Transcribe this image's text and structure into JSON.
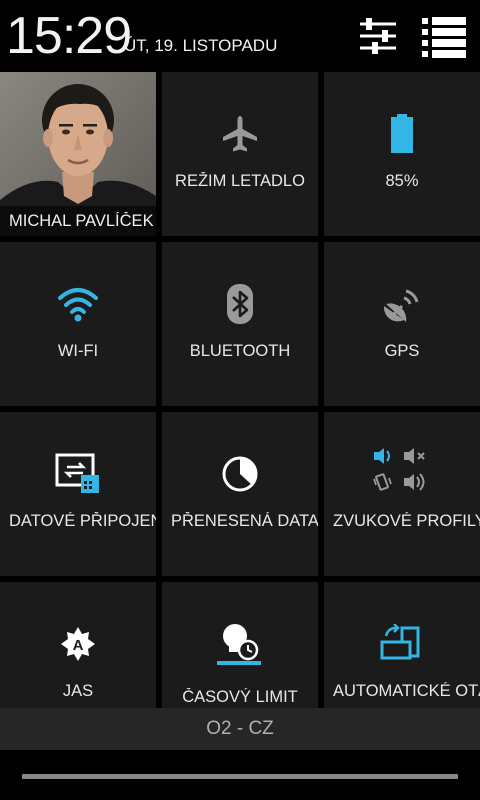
{
  "status": {
    "time": "15:29",
    "date": "ÚT, 19. LISTOPADU"
  },
  "header": {
    "settings_icon": "sliders-icon",
    "list_icon": "list-icon"
  },
  "tiles": {
    "user": {
      "name": "MICHAL PAVLÍČEK"
    },
    "airplane": {
      "label": "REŽIM LETADLO",
      "icon": "airplane-icon"
    },
    "battery": {
      "label": "85%",
      "icon": "battery-icon",
      "level": 0.85
    },
    "wifi": {
      "label": "WI-FI",
      "icon": "wifi-icon"
    },
    "bluetooth": {
      "label": "BLUETOOTH",
      "icon": "bluetooth-icon"
    },
    "gps": {
      "label": "GPS",
      "icon": "gps-icon"
    },
    "data": {
      "label": "DATOVÉ PŘIPOJENÍ",
      "icon": "data-connection-icon"
    },
    "usage": {
      "label": "PŘENESENÁ DATA",
      "icon": "data-usage-icon"
    },
    "sound": {
      "label": "ZVUKOVÉ PROFILY",
      "icon": "sound-profile-icon"
    },
    "brightness": {
      "label": "JAS",
      "icon": "brightness-icon"
    },
    "timeout": {
      "label": "ČASOVÝ LIMIT",
      "icon": "screen-timeout-icon"
    },
    "rotate": {
      "label": "AUTOMATICKÉ OTÁČENÍ",
      "icon": "auto-rotate-icon"
    }
  },
  "carrier": "O2 - CZ",
  "colors": {
    "accent": "#33b5e5",
    "tile_bg": "#1b1b1b",
    "icon_gray": "#9a9a9a",
    "icon_white": "#ffffff"
  }
}
